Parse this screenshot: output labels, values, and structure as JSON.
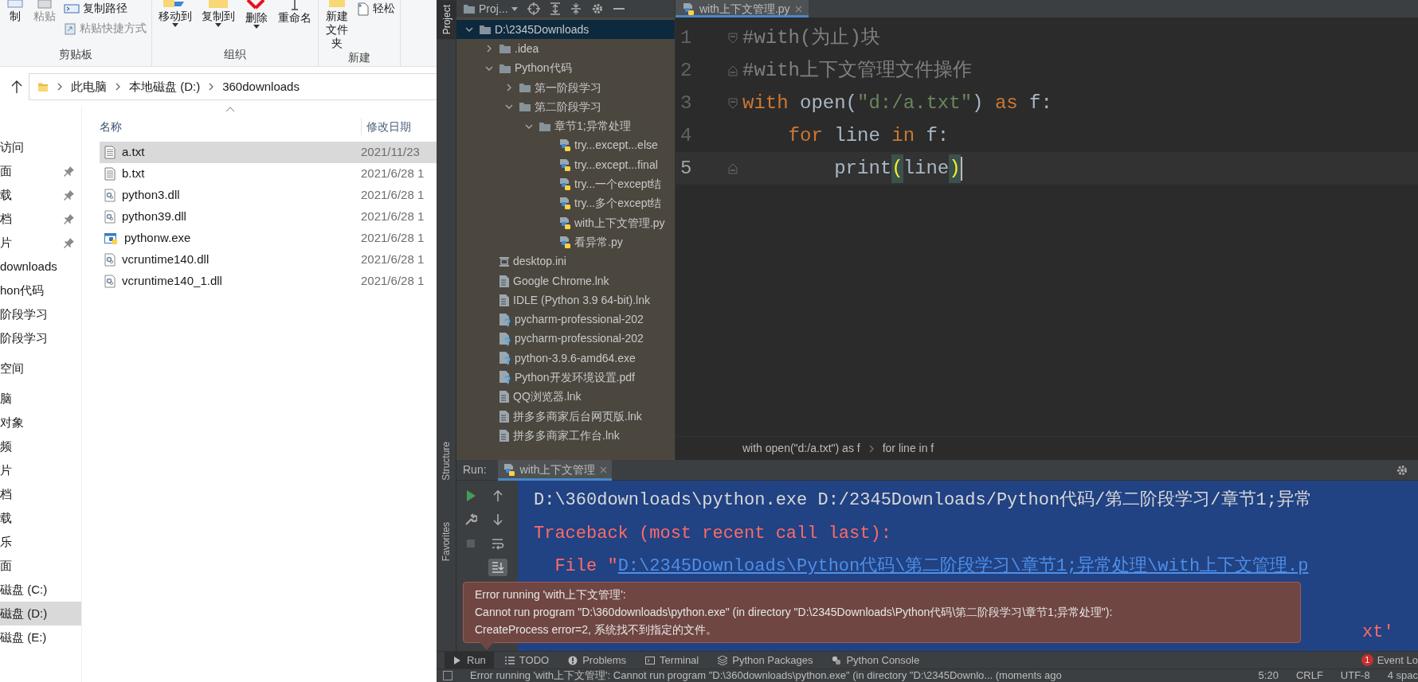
{
  "explorer": {
    "ribbon": {
      "groups": [
        {
          "label": "剪贴板",
          "buttons": [
            {
              "label": "制",
              "kind": "large",
              "dropdown": false,
              "disabled": false
            },
            {
              "label": "粘贴",
              "kind": "large",
              "dropdown": false,
              "disabled": true
            },
            {
              "label": "复制路径",
              "kind": "small",
              "dropdown": false,
              "disabled": false
            },
            {
              "label": "粘贴快捷方式",
              "kind": "small",
              "dropdown": false,
              "disabled": true
            }
          ]
        },
        {
          "label": "组织",
          "buttons": [
            {
              "label": "移动到",
              "kind": "large",
              "dropdown": true,
              "disabled": false
            },
            {
              "label": "复制到",
              "kind": "large",
              "dropdown": true,
              "disabled": false
            },
            {
              "label": "删除",
              "kind": "large",
              "dropdown": true,
              "disabled": false
            },
            {
              "label": "重命名",
              "kind": "large",
              "dropdown": false,
              "disabled": false
            }
          ]
        },
        {
          "label": "新建",
          "buttons": [
            {
              "label": "新建文件夹",
              "kind": "large",
              "dropdown": false,
              "disabled": false
            },
            {
              "label": "轻松",
              "kind": "small",
              "dropdown": false,
              "disabled": false
            }
          ]
        }
      ]
    },
    "address": {
      "crumbs": [
        "此电脑",
        "本地磁盘 (D:)",
        "360downloads"
      ]
    },
    "sidebar": {
      "sections": [
        {
          "items": [
            {
              "label": "访问",
              "pinned": false,
              "selected": false
            },
            {
              "label": "面",
              "pinned": true,
              "selected": false
            },
            {
              "label": "载",
              "pinned": true,
              "selected": false
            },
            {
              "label": "档",
              "pinned": true,
              "selected": false
            },
            {
              "label": "片",
              "pinned": true,
              "selected": false
            },
            {
              "label": "downloads",
              "pinned": false,
              "selected": false
            },
            {
              "label": "hon代码",
              "pinned": false,
              "selected": false
            },
            {
              "label": "阶段学习",
              "pinned": false,
              "selected": false
            },
            {
              "label": "阶段学习",
              "pinned": false,
              "selected": false
            }
          ]
        },
        {
          "items": [
            {
              "label": "空间",
              "pinned": false,
              "selected": false
            }
          ]
        },
        {
          "items": [
            {
              "label": "脑",
              "pinned": false,
              "selected": false
            },
            {
              "label": "对象",
              "pinned": false,
              "selected": false
            },
            {
              "label": "频",
              "pinned": false,
              "selected": false
            },
            {
              "label": "片",
              "pinned": false,
              "selected": false
            },
            {
              "label": "档",
              "pinned": false,
              "selected": false
            },
            {
              "label": "载",
              "pinned": false,
              "selected": false
            },
            {
              "label": "乐",
              "pinned": false,
              "selected": false
            },
            {
              "label": "面",
              "pinned": false,
              "selected": false
            },
            {
              "label": "磁盘 (C:)",
              "pinned": false,
              "selected": false
            },
            {
              "label": "磁盘 (D:)",
              "pinned": false,
              "selected": true
            },
            {
              "label": "磁盘 (E:)",
              "pinned": false,
              "selected": false
            }
          ]
        }
      ]
    },
    "file_list": {
      "columns": [
        {
          "label": "名称",
          "sorted": true
        },
        {
          "label": "修改日期",
          "sorted": false
        }
      ],
      "rows": [
        {
          "kind": "text",
          "name": "a.txt",
          "date": "2021/11/23",
          "selected": true
        },
        {
          "kind": "text",
          "name": "b.txt",
          "date": "2021/6/28 1",
          "selected": false
        },
        {
          "kind": "library",
          "name": "python3.dll",
          "date": "2021/6/28 1",
          "selected": false
        },
        {
          "kind": "library",
          "name": "python39.dll",
          "date": "2021/6/28 1",
          "selected": false
        },
        {
          "kind": "program",
          "name": "pythonw.exe",
          "date": "2021/6/28 1",
          "selected": false
        },
        {
          "kind": "library",
          "name": "vcruntime140.dll",
          "date": "2021/6/28 1",
          "selected": false
        },
        {
          "kind": "library",
          "name": "vcruntime140_1.dll",
          "date": "2021/6/28 1",
          "selected": false
        }
      ]
    }
  },
  "ide": {
    "side_tabs": [
      {
        "label": "Project",
        "selected": true
      },
      {
        "label": "Structure",
        "selected": false
      },
      {
        "label": "Favorites",
        "selected": false
      }
    ],
    "project": {
      "title": "Proj...",
      "tree": [
        {
          "label": "D:\\2345Downloads",
          "kind": "folder",
          "expanded": true,
          "selected": true,
          "children": [
            {
              "label": ".idea",
              "kind": "folder",
              "expanded": false,
              "selected": false
            },
            {
              "label": "Python代码",
              "kind": "folder",
              "expanded": true,
              "selected": false,
              "children": [
                {
                  "label": "第一阶段学习",
                  "kind": "folder",
                  "expanded": false,
                  "selected": false
                },
                {
                  "label": "第二阶段学习",
                  "kind": "folder",
                  "expanded": true,
                  "selected": false,
                  "children": [
                    {
                      "label": "章节1;异常处理",
                      "kind": "folder",
                      "expanded": true,
                      "selected": false,
                      "children": [
                        {
                          "label": "try...except...else",
                          "kind": "python",
                          "selected": false
                        },
                        {
                          "label": "try...except...final",
                          "kind": "python",
                          "selected": false
                        },
                        {
                          "label": "try...一个except结",
                          "kind": "python",
                          "selected": false
                        },
                        {
                          "label": "try...多个except结",
                          "kind": "python",
                          "selected": false
                        },
                        {
                          "label": "with上下文管理.py",
                          "kind": "python",
                          "selected": false
                        },
                        {
                          "label": "看异常.py",
                          "kind": "python",
                          "selected": false
                        }
                      ]
                    }
                  ]
                }
              ]
            },
            {
              "label": "desktop.ini",
              "kind": "settings",
              "selected": false
            },
            {
              "label": "Google Chrome.lnk",
              "kind": "shortcut",
              "selected": false
            },
            {
              "label": "IDLE (Python 3.9 64-bit).lnk",
              "kind": "shortcut",
              "selected": false
            },
            {
              "label": "pycharm-professional-202",
              "kind": "unknown",
              "selected": false
            },
            {
              "label": "pycharm-professional-202",
              "kind": "unknown",
              "selected": false
            },
            {
              "label": "python-3.9.6-amd64.exe",
              "kind": "unknown",
              "selected": false
            },
            {
              "label": "Python开发环境设置.pdf",
              "kind": "unknown",
              "selected": false
            },
            {
              "label": "QQ浏览器.lnk",
              "kind": "shortcut",
              "selected": false
            },
            {
              "label": "拼多多商家后台网页版.lnk",
              "kind": "shortcut",
              "selected": false
            },
            {
              "label": "拼多多商家工作台.lnk",
              "kind": "shortcut",
              "selected": false
            }
          ]
        }
      ]
    },
    "editor": {
      "tab": {
        "label": "with上下文管理.py",
        "selected": true
      },
      "lines": [
        {
          "number": "1",
          "kind": "fold-start",
          "current": false,
          "tokens": [
            {
              "text": "#with(为止)块",
              "kind": "comment"
            }
          ]
        },
        {
          "number": "2",
          "kind": "fold-end",
          "current": false,
          "tokens": [
            {
              "text": "#with上下文管理文件操作",
              "kind": "comment"
            }
          ]
        },
        {
          "number": "3",
          "kind": "fold-start",
          "current": false,
          "tokens": [
            {
              "text": "with",
              "kind": "keyword"
            },
            {
              "text": " open(",
              "kind": "plain"
            },
            {
              "text": "\"d:/a.txt\"",
              "kind": "string"
            },
            {
              "text": ") ",
              "kind": "plain"
            },
            {
              "text": "as",
              "kind": "keyword"
            },
            {
              "text": " f:",
              "kind": "plain"
            }
          ]
        },
        {
          "number": "4",
          "kind": "plain",
          "current": false,
          "tokens": [
            {
              "text": "    for",
              "kind": "keyword"
            },
            {
              "text": " line ",
              "kind": "plain"
            },
            {
              "text": "in",
              "kind": "keyword"
            },
            {
              "text": " f:",
              "kind": "plain"
            }
          ]
        },
        {
          "number": "5",
          "kind": "fold-end",
          "current": true,
          "tokens": [
            {
              "text": "        print",
              "kind": "plain"
            },
            {
              "text": "(",
              "kind": "match"
            },
            {
              "text": "line",
              "kind": "plain"
            },
            {
              "text": ")",
              "kind": "match"
            }
          ]
        }
      ],
      "breadcrumbs": [
        "with open(\"d:/a.txt\") as f",
        "for line in f"
      ]
    },
    "run": {
      "label": "Run:",
      "tab": {
        "label": "with上下文管理",
        "selected": true
      },
      "console": [
        {
          "kind": "full",
          "parts": [
            {
              "text": "D:\\360downloads\\python.exe D:/2345Downloads/Python代码/第二阶段学习/章节1;异常",
              "kind": "plain"
            }
          ]
        },
        {
          "kind": "full",
          "parts": [
            {
              "text": "Traceback (most recent call last):",
              "kind": "error"
            }
          ]
        },
        {
          "kind": "full",
          "parts": [
            {
              "text": "  File \"",
              "kind": "error"
            },
            {
              "text": "D:\\2345Downloads\\Python代码\\第二阶段学习\\章节1;异常处理\\with上下文管理.p",
              "kind": "link"
            }
          ]
        },
        {
          "kind": "obscured",
          "parts": [
            {
              "text": "xt'",
              "kind": "error"
            }
          ]
        }
      ]
    },
    "popup": {
      "lines": [
        "Error running 'with上下文管理':",
        "Cannot run program \"D:\\360downloads\\python.exe\" (in directory \"D:\\2345Downloads\\Python代码\\第二阶段学习\\章节1;异常处理\"):",
        "CreateProcess error=2, 系统找不到指定的文件。"
      ]
    },
    "tool_tabs": [
      {
        "label": "Run",
        "selected": true
      },
      {
        "label": "TODO",
        "selected": false
      },
      {
        "label": "Problems",
        "selected": false
      },
      {
        "label": "Terminal",
        "selected": false
      },
      {
        "label": "Python Packages",
        "selected": false
      },
      {
        "label": "Python Console",
        "selected": false
      }
    ],
    "event_log": {
      "count": "1",
      "label": "Event Lo"
    },
    "status": {
      "message": "Error running 'with上下文管理': Cannot run program \"D:\\360downloads\\python.exe\" (in directory \"D:\\2345Downlo... (moments ago",
      "items": [
        "5:20",
        "CRLF",
        "UTF-8",
        "4 spac"
      ]
    }
  }
}
